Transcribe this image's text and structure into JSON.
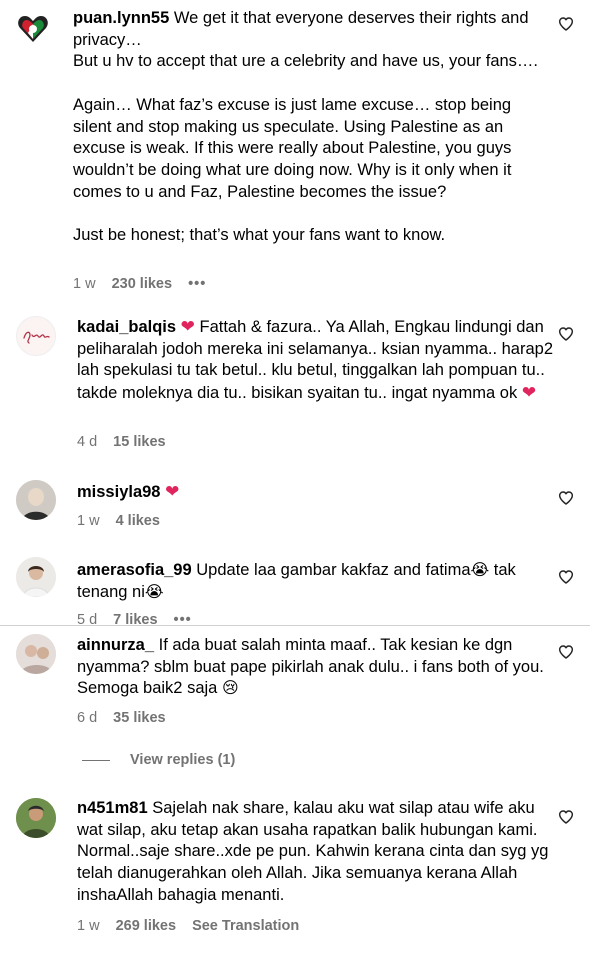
{
  "comments": [
    {
      "username": "puan.lynn55",
      "text": " We get it that everyone deserves their rights and privacy…\nBut u hv to accept that ure a celebrity and have us, your fans….\n\nAgain… What faz’s excuse is just lame excuse… stop being silent and stop making us speculate. Using Palestine as an excuse is weak. If this were really about Palestine, you guys wouldn’t be doing what ure doing now. Why is it only when it comes to u and Faz, Palestine becomes the issue?\n\nJust be honest; that’s what your fans want to know.",
      "time": "1 w",
      "likes": "230 likes",
      "more": "•••"
    },
    {
      "username": "kadai_balqis",
      "text_before": " ",
      "text": " Fattah & fazura.. Ya Allah, Engkau lindungi dan peliharalah jodoh mereka ini selamanya.. ksian nyamma.. harap2 lah spekulasi tu tak betul.. klu betul, tinggalkan lah pompuan tu.. takde moleknya dia tu.. bisikan syaitan tu.. ingat nyamma ok ",
      "emoji_heart": "❤",
      "time": "4 d",
      "likes": "15 likes"
    },
    {
      "username": "missiyla98",
      "emoji_heart": "❤",
      "time": "1 w",
      "likes": "4 likes"
    },
    {
      "username": "amerasofia_99",
      "text": " Update laa gambar kakfaz and fatima",
      "emoji_cry": "😭",
      "text_after": " tak tenang ni",
      "time": "5 d",
      "likes": "7 likes",
      "more": "•••"
    },
    {
      "username": "ainnurza_",
      "text": " If ada buat salah minta maaf.. Tak kesian ke dgn nyamma? sblm buat pape pikirlah anak dulu.. i fans both of you. Semoga baik2 saja ",
      "emoji_sad": "😢",
      "time": "6 d",
      "likes": "35 likes",
      "view_replies": "View replies (1)"
    },
    {
      "username": "n451m81",
      "text": " Sajelah nak share, kalau aku wat silap atau wife aku wat silap, aku tetap akan usaha rapatkan balik hubungan kami. Normal..saje share..xde pe pun. Kahwin kerana cinta dan syg yg telah dianugerahkan oleh Allah. Jika semuanya kerana Allah inshaAllah bahagia menanti.",
      "time": "1 w",
      "likes": "269 likes",
      "translation": "See Translation"
    }
  ],
  "icons": {
    "like": "heart-outline-icon"
  },
  "colors": {
    "meta": "#737373",
    "heart": "#e0245e"
  }
}
